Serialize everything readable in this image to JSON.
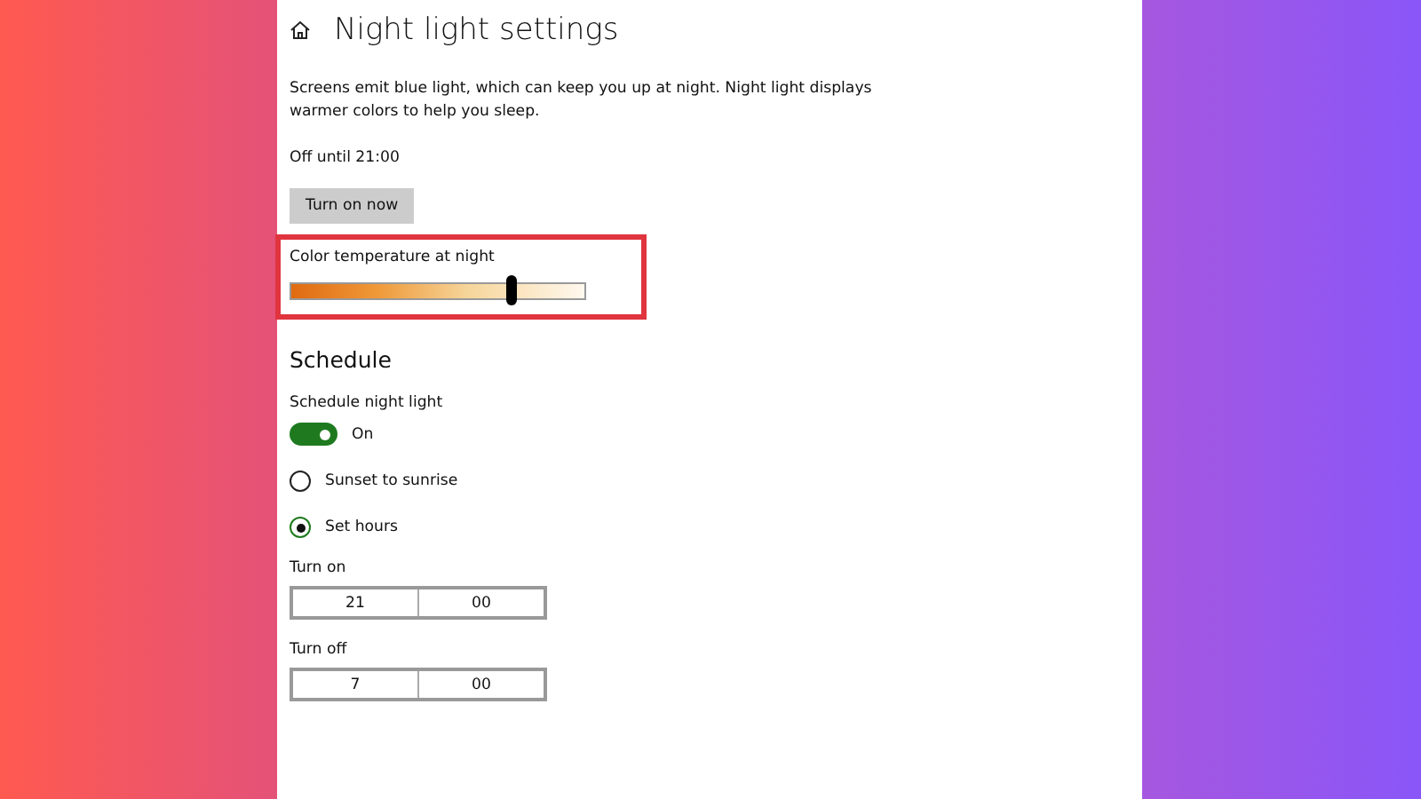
{
  "page": {
    "title": "Night light settings",
    "description": "Screens emit blue light, which can keep you up at night. Night light displays warmer colors to help you sleep.",
    "status": "Off until 21:00",
    "button": "Turn on now"
  },
  "color_temperature": {
    "label": "Color temperature at night",
    "level": 0.75,
    "highlighted": true
  },
  "schedule": {
    "heading": "Schedule",
    "toggle_label": "Schedule night light",
    "toggle": {
      "on": true,
      "state_text": "On"
    },
    "options": [
      {
        "label": "Sunset to sunrise",
        "selected": false
      },
      {
        "label": "Set hours",
        "selected": true
      }
    ],
    "times": [
      {
        "label": "Turn on",
        "hour": "21",
        "minute": "00"
      },
      {
        "label": "Turn off",
        "hour": "7",
        "minute": "00"
      }
    ]
  }
}
